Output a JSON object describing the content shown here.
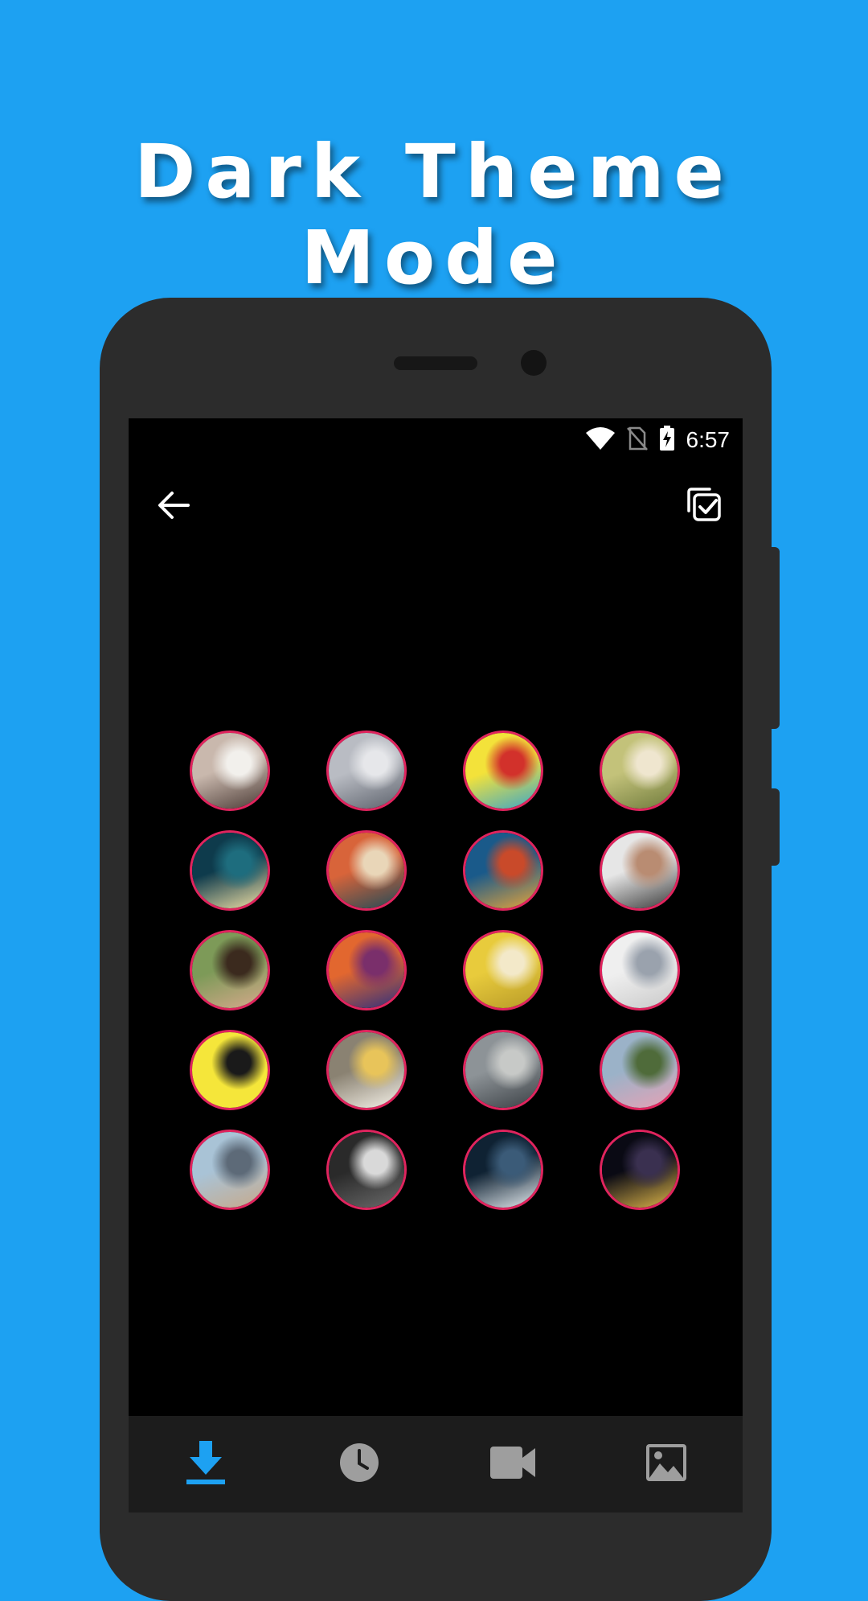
{
  "promo": {
    "headline": "Dark Theme Mode"
  },
  "status_bar": {
    "time": "6:57",
    "icons": [
      "wifi-icon",
      "no-sim-icon",
      "battery-charging-icon"
    ]
  },
  "toolbar": {
    "back_icon": "arrow-back-icon",
    "select_icon": "select-all-icon"
  },
  "gallery": {
    "accent_border": "#e0245e",
    "items": [
      {
        "name": "person-with-cat",
        "colors": [
          "#c9b8ad",
          "#4a3a35",
          "#f2f0ec"
        ]
      },
      {
        "name": "rainy-window-person",
        "colors": [
          "#b9bcc3",
          "#5c616b",
          "#e6e7ea"
        ]
      },
      {
        "name": "cartoon-sponge",
        "colors": [
          "#f3e23a",
          "#3aa6c9",
          "#d2312b"
        ]
      },
      {
        "name": "kitten-on-grass",
        "colors": [
          "#c3c27a",
          "#6f7a3c",
          "#efe6cf"
        ]
      },
      {
        "name": "moon-over-sea",
        "colors": [
          "#0e3b4c",
          "#f4e2a6",
          "#1e6d7e"
        ]
      },
      {
        "name": "wave-artwork",
        "colors": [
          "#d8643a",
          "#1f4a57",
          "#e9d6b8"
        ]
      },
      {
        "name": "sunset-mountains",
        "colors": [
          "#1a5a8a",
          "#e9a53a",
          "#c94a2a"
        ]
      },
      {
        "name": "man-drinking",
        "colors": [
          "#e6e6e6",
          "#3a3a3a",
          "#b98c72"
        ]
      },
      {
        "name": "woman-portrait",
        "colors": [
          "#7d9a58",
          "#d7a98c",
          "#3b2a1e"
        ]
      },
      {
        "name": "pier-sunset",
        "colors": [
          "#e2672f",
          "#2d2f7e",
          "#7a2f6b"
        ]
      },
      {
        "name": "yellow-pear",
        "colors": [
          "#e8cb3c",
          "#b89a28",
          "#f3e9c9"
        ]
      },
      {
        "name": "flowers-on-wall",
        "colors": [
          "#efefef",
          "#c9c9c9",
          "#9aa2ad"
        ]
      },
      {
        "name": "signature-yellow",
        "colors": [
          "#f5e63a",
          "#f5e63a",
          "#1a1a1a"
        ]
      },
      {
        "name": "white-flower",
        "colors": [
          "#8a8272",
          "#f7f3ea",
          "#e8c45a"
        ]
      },
      {
        "name": "rock-person-sea",
        "colors": [
          "#8d9397",
          "#3a3f44",
          "#c7c9c7"
        ]
      },
      {
        "name": "pink-blossoms",
        "colors": [
          "#9bb2c8",
          "#e6a2b5",
          "#4f6b3a"
        ]
      },
      {
        "name": "beach-walker",
        "colors": [
          "#a9c3d6",
          "#c7a98a",
          "#5d6a78"
        ]
      },
      {
        "name": "dark-portrait",
        "colors": [
          "#2a2a2a",
          "#6b6b6b",
          "#d9d9d9"
        ]
      },
      {
        "name": "ocean-waves",
        "colors": [
          "#0f2233",
          "#e8eef2",
          "#3b5b78"
        ]
      },
      {
        "name": "night-city",
        "colors": [
          "#0a0a14",
          "#e0b84a",
          "#3a3050"
        ]
      }
    ]
  },
  "bottom_nav": {
    "active_color": "#1da1f2",
    "inactive_color": "#9e9e9e",
    "items": [
      {
        "icon": "download-icon",
        "active": true
      },
      {
        "icon": "history-clock-icon",
        "active": false
      },
      {
        "icon": "video-camera-icon",
        "active": false
      },
      {
        "icon": "image-icon",
        "active": false
      }
    ]
  }
}
